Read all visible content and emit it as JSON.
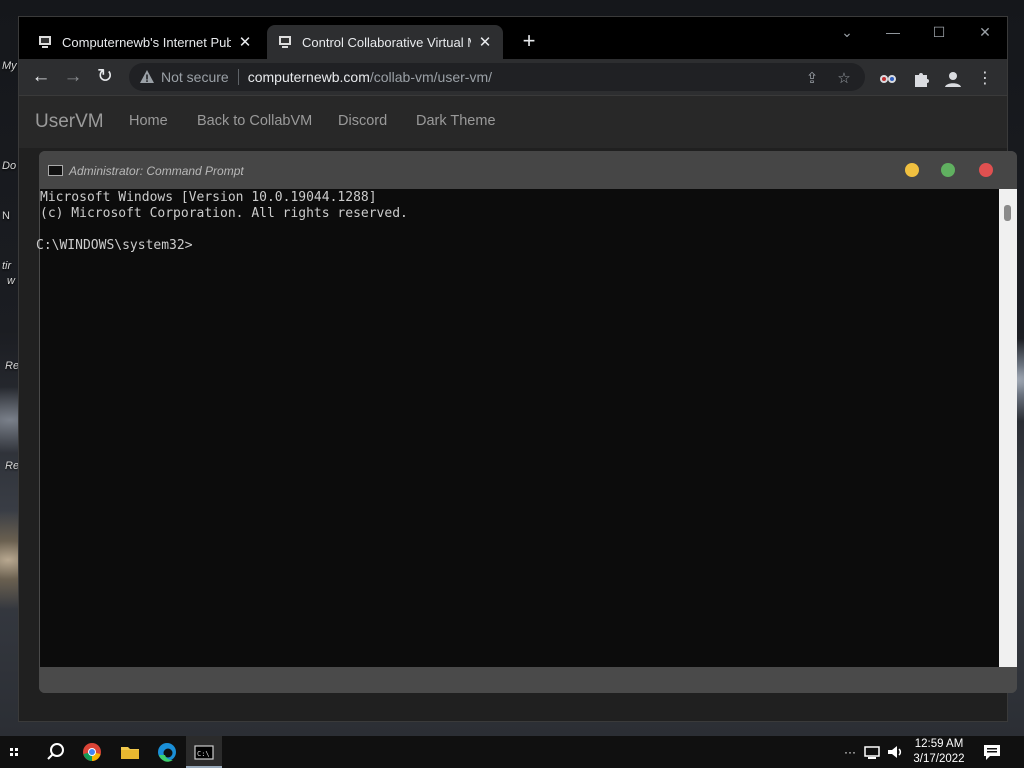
{
  "desktop": {
    "icon_labels": [
      "My",
      "Do",
      "N",
      "tir",
      "w",
      "Re",
      "Re"
    ]
  },
  "browser": {
    "tabs": [
      {
        "title": "Computernewb's Internet Pub H",
        "close": "✕",
        "active": false
      },
      {
        "title": "Control Collaborative Virtual Ma",
        "close": "✕",
        "active": true
      }
    ],
    "new_tab": "+",
    "window_controls": {
      "dropdown": "⌄",
      "minimize": "—",
      "maximize": "☐",
      "close": "✕"
    },
    "toolbar": {
      "back": "←",
      "forward": "→",
      "reload": "↻",
      "security_label": "Not secure",
      "url_host": "computernewb.com",
      "url_path": "/collab-vm/user-vm/"
    }
  },
  "page": {
    "brand": "UserVM",
    "nav": [
      "Home",
      "Back to CollabVM",
      "Discord",
      "Dark Theme"
    ],
    "vm_window": {
      "title": "Administrator: Command Prompt",
      "console_lines": [
        "Microsoft Windows [Version 10.0.19044.1288]",
        "(c) Microsoft Corporation. All rights reserved.",
        "",
        "C:\\WINDOWS\\system32>"
      ],
      "dot_colors": {
        "yellow": "#f0c040",
        "green": "#60b060",
        "red": "#e05050"
      }
    }
  },
  "taskbar": {
    "time": "12:59 AM",
    "date": "3/17/2022",
    "overflow": "···"
  },
  "colors": {
    "accent": "#5b8fd6",
    "console_bg": "#0c0c0c",
    "console_fg": "#cccccc"
  }
}
